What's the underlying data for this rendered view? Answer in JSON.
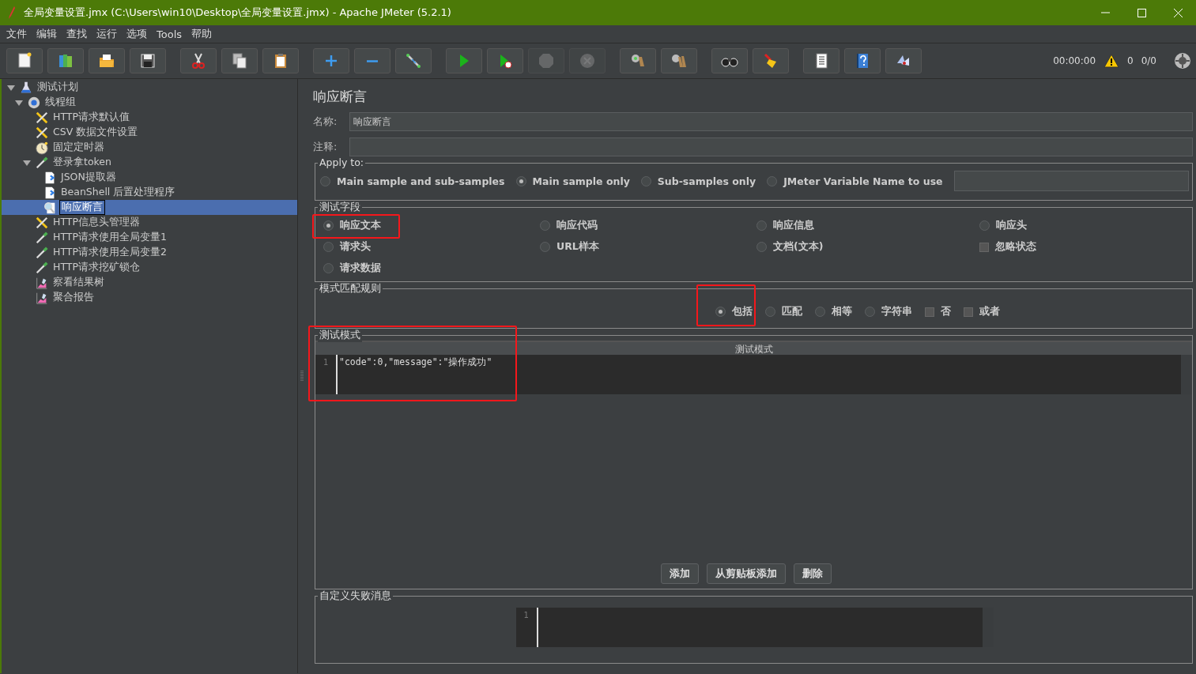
{
  "window": {
    "title": "全局变量设置.jmx (C:\\Users\\win10\\Desktop\\全局变量设置.jmx) - Apache JMeter (5.2.1)"
  },
  "menu": [
    "文件",
    "编辑",
    "查找",
    "运行",
    "选项",
    "Tools",
    "帮助"
  ],
  "toolbar": {
    "groups": [
      [
        {
          "disabled": false
        },
        {
          "disabled": false
        },
        {
          "disabled": false
        },
        {
          "disabled": false
        }
      ],
      [
        {
          "disabled": false
        },
        {
          "disabled": false
        },
        {
          "disabled": false
        }
      ],
      [
        {
          "disabled": false
        },
        {
          "disabled": false
        },
        {
          "disabled": false
        }
      ],
      [
        {
          "disabled": false
        },
        {
          "disabled": false
        },
        {
          "disabled": true
        },
        {
          "disabled": true
        }
      ],
      [
        {
          "disabled": false
        },
        {
          "disabled": false
        }
      ],
      [
        {
          "disabled": false
        },
        {
          "disabled": false
        }
      ],
      [
        {
          "disabled": false
        },
        {
          "disabled": false
        },
        {
          "disabled": false
        }
      ]
    ],
    "timer": "00:00:00",
    "warnings": "0",
    "threads": "0/0"
  },
  "tree": [
    {
      "label": "测试计划",
      "kind": "plan",
      "selected": false,
      "expanded": true,
      "children": [
        {
          "label": "线程组",
          "kind": "threadgroup",
          "selected": false,
          "expanded": true,
          "children": [
            {
              "label": "HTTP请求默认值",
              "kind": "config",
              "selected": false
            },
            {
              "label": "CSV 数据文件设置",
              "kind": "config",
              "selected": false
            },
            {
              "label": "固定定时器",
              "kind": "timer",
              "selected": false
            },
            {
              "label": "登录拿token",
              "kind": "sampler",
              "selected": false,
              "expanded": true,
              "children": [
                {
                  "label": "JSON提取器",
                  "kind": "postprocessor",
                  "selected": false
                },
                {
                  "label": "BeanShell 后置处理程序",
                  "kind": "postprocessor",
                  "selected": false
                },
                {
                  "label": "响应断言",
                  "kind": "assertion",
                  "selected": true
                }
              ]
            },
            {
              "label": "HTTP信息头管理器",
              "kind": "config",
              "selected": false
            },
            {
              "label": "HTTP请求使用全局变量1",
              "kind": "sampler",
              "selected": false
            },
            {
              "label": "HTTP请求使用全局变量2",
              "kind": "sampler",
              "selected": false
            },
            {
              "label": "HTTP请求挖矿锁仓",
              "kind": "sampler",
              "selected": false
            },
            {
              "label": "察看结果树",
              "kind": "listener",
              "selected": false
            },
            {
              "label": "聚合报告",
              "kind": "listener",
              "selected": false
            }
          ]
        }
      ]
    }
  ],
  "panel": {
    "title": "响应断言",
    "name_field": {
      "label": "名称:",
      "value": "响应断言"
    },
    "comment_field": {
      "label": "注释:"
    },
    "apply_to": {
      "legend": "Apply to:",
      "options": [
        {
          "label": "Main sample and sub-samples",
          "selected": false
        },
        {
          "label": "Main sample only",
          "selected": true
        },
        {
          "label": "Sub-samples only",
          "selected": false
        },
        {
          "label": "JMeter Variable Name to use",
          "selected": false
        }
      ]
    },
    "test_field": {
      "legend": "测试字段",
      "items": [
        {
          "kind": "radio",
          "label": "响应文本",
          "selected": true,
          "highlighted": true
        },
        {
          "kind": "radio",
          "label": "响应代码",
          "selected": false,
          "highlighted": false
        },
        {
          "kind": "radio",
          "label": "响应信息",
          "selected": false,
          "highlighted": false
        },
        {
          "kind": "radio",
          "label": "响应头",
          "selected": false,
          "highlighted": false
        },
        {
          "kind": "radio",
          "label": "请求头",
          "selected": false,
          "highlighted": false
        },
        {
          "kind": "radio",
          "label": "URL样本",
          "selected": false,
          "highlighted": false
        },
        {
          "kind": "radio",
          "label": "文档(文本)",
          "selected": false,
          "highlighted": false
        },
        {
          "kind": "checkbox",
          "label": "忽略状态",
          "checked": false,
          "highlighted": false
        },
        {
          "kind": "radio",
          "label": "请求数据",
          "selected": false,
          "highlighted": false
        }
      ]
    },
    "match_rules": {
      "legend": "模式匹配规则",
      "items": [
        {
          "kind": "radio",
          "label": "包括",
          "selected": true,
          "highlighted": true
        },
        {
          "kind": "radio",
          "label": "匹配",
          "selected": false,
          "highlighted": false
        },
        {
          "kind": "radio",
          "label": "相等",
          "selected": false,
          "highlighted": false
        },
        {
          "kind": "radio",
          "label": "字符串",
          "selected": false,
          "highlighted": false
        },
        {
          "kind": "checkbox",
          "label": "否",
          "checked": false,
          "highlighted": false
        },
        {
          "kind": "checkbox",
          "label": "或者",
          "checked": false,
          "highlighted": false
        }
      ]
    },
    "patterns": {
      "legend": "测试模式",
      "highlighted": true,
      "column": "测试模式",
      "lines": [
        {
          "number": "1",
          "text": "\"code\":0,\"message\":\"操作成功\""
        }
      ],
      "buttons": [
        "添加",
        "从剪贴板添加",
        "删除"
      ]
    },
    "failure_message": {
      "legend": "自定义失败消息",
      "lines": [
        {
          "number": "1"
        }
      ]
    }
  }
}
